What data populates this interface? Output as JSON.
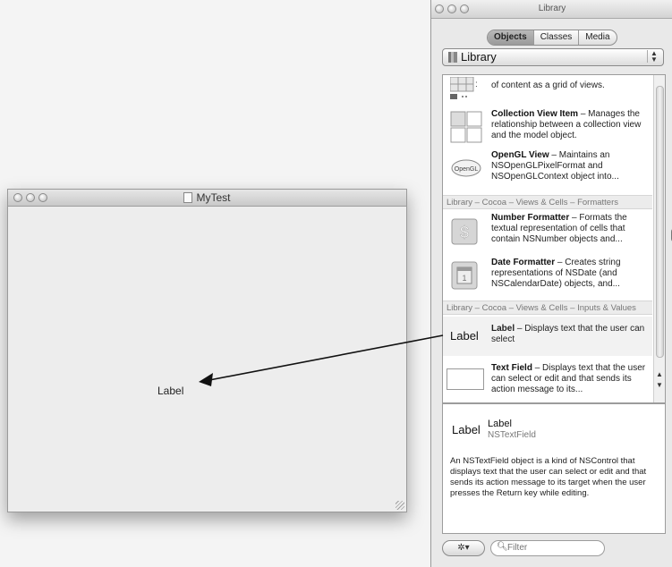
{
  "mytest_window": {
    "title": "MyTest",
    "label_text": "Label"
  },
  "library_panel": {
    "title": "Library",
    "segments": [
      "Objects",
      "Classes",
      "Media"
    ],
    "selected_segment": "Objects",
    "popup_value": "Library",
    "items": [
      {
        "text": "of content as a grid of views."
      },
      {
        "title": "Collection View Item",
        "desc": " – Manages the relationship between a collection view and the model object."
      },
      {
        "title": "OpenGL View",
        "desc": " – Maintains an NSOpenGLPixelFormat and NSOpenGLContext object into..."
      },
      {
        "section": "Library – Cocoa – Views & Cells – Formatters"
      },
      {
        "title": "Number Formatter",
        "desc": " – Formats the textual representation of cells that contain NSNumber objects and..."
      },
      {
        "title": "Date Formatter",
        "desc": " – Creates string representations of NSDate (and NSCalendarDate) objects, and..."
      },
      {
        "section": "Library – Cocoa – Views & Cells – Inputs & Values"
      },
      {
        "icon_text": "Label",
        "title": "Label",
        "desc": " – Displays text that the user can select"
      },
      {
        "title": "Text Field",
        "desc": " – Displays text that the user can select or edit and that sends its action message to its..."
      }
    ],
    "opengl_icon_text": "OpenGL",
    "info": {
      "big_label": "Label",
      "name": "Label",
      "class": "NSTextField",
      "description": "An NSTextField object is a kind of NSControl that displays text that the user can select or edit and that sends its action message to its target when the user presses the Return key while editing."
    },
    "filter_placeholder": "Filter"
  }
}
